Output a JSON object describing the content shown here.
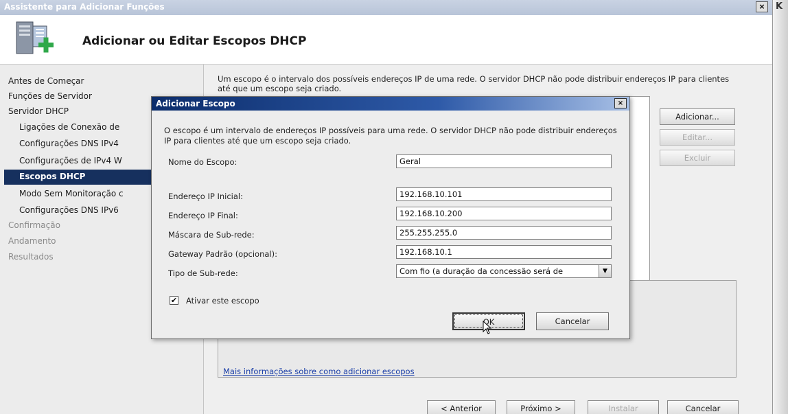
{
  "window": {
    "title": "Assistente para Adicionar Funções",
    "close_glyph": "×",
    "edge_glyph": "K"
  },
  "header": {
    "title": "Adicionar ou Editar Escopos DHCP"
  },
  "nav": {
    "items": [
      {
        "label": "Antes de Começar"
      },
      {
        "label": "Funções de Servidor"
      },
      {
        "label": "Servidor DHCP"
      },
      {
        "label": "Ligações de Conexão de"
      },
      {
        "label": "Configurações DNS IPv4"
      },
      {
        "label": "Configurações de IPv4 W"
      },
      {
        "label": "Escopos DHCP"
      },
      {
        "label": "Modo Sem Monitoração c"
      },
      {
        "label": "Configurações DNS IPv6"
      },
      {
        "label": "Confirmação"
      },
      {
        "label": "Andamento"
      },
      {
        "label": "Resultados"
      }
    ]
  },
  "content": {
    "description": "Um escopo é o intervalo dos possíveis endereços IP de uma rede. O servidor DHCP não pode distribuir endereços IP para clientes até que um escopo seja criado.",
    "add_button": "Adicionar...",
    "edit_button": "Editar...",
    "delete_button": "Excluir",
    "more_info_link": "Mais informações sobre como adicionar escopos"
  },
  "footer": {
    "previous": "< Anterior",
    "next": "Próximo >",
    "install": "Instalar",
    "cancel": "Cancelar"
  },
  "dialog": {
    "title": "Adicionar Escopo",
    "close_glyph": "×",
    "description": "O escopo é um intervalo de endereços IP possíveis para uma rede. O servidor DHCP não pode distribuir endereços IP para clientes até que um escopo seja criado.",
    "fields": {
      "scope_name": {
        "label": "Nome do Escopo:",
        "value": "Geral"
      },
      "start_ip": {
        "label": "Endereço IP Inicial:",
        "value": "192.168.10.101"
      },
      "end_ip": {
        "label": "Endereço IP Final:",
        "value": "192.168.10.200"
      },
      "subnet_mask": {
        "label": "Máscara de Sub-rede:",
        "value": "255.255.255.0"
      },
      "gateway": {
        "label": "Gateway Padrão (opcional):",
        "value": "192.168.10.1"
      },
      "subnet_type": {
        "label": "Tipo de Sub-rede:",
        "value": "Com fio (a duração da concessão será de"
      }
    },
    "activate_checkbox": {
      "label": "Ativar este escopo",
      "checked_glyph": "✔"
    },
    "ok_button": "OK",
    "cancel_button": "Cancelar"
  },
  "colors": {
    "nav_active_bg": "#16305e",
    "dialog_title_bg": "#0c2d6b",
    "link": "#1b3fa8"
  }
}
